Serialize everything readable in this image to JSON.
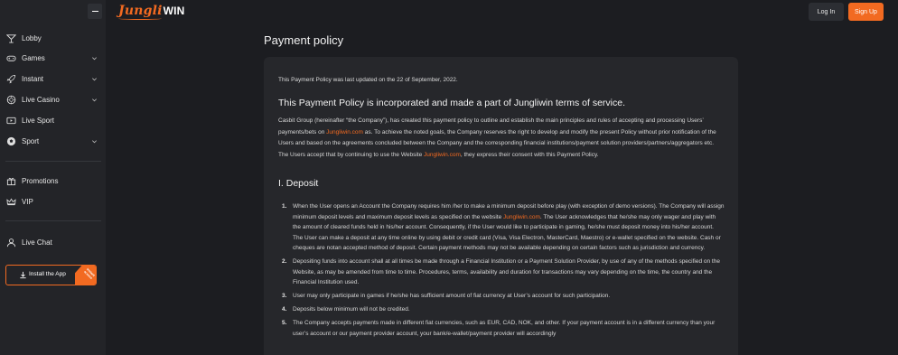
{
  "header": {
    "logo_main": "Jungli",
    "logo_accent": "WIN",
    "login_label": "Log In",
    "signup_label": "Sign Up"
  },
  "sidebar": {
    "items": [
      {
        "label": "Lobby",
        "icon": "cocktail-glass-icon",
        "chevron": false
      },
      {
        "label": "Games",
        "icon": "gamepad-icon",
        "chevron": true
      },
      {
        "label": "Instant",
        "icon": "rocket-icon",
        "chevron": true
      },
      {
        "label": "Live Casino",
        "icon": "casino-chip-icon",
        "chevron": true
      },
      {
        "label": "Live Sport",
        "icon": "live-tv-icon",
        "chevron": false
      },
      {
        "label": "Sport",
        "icon": "soccer-ball-icon",
        "chevron": true
      },
      {
        "label": "Promotions",
        "icon": "gift-icon",
        "chevron": false
      },
      {
        "label": "VIP",
        "icon": "crown-icon",
        "chevron": false
      },
      {
        "label": "Live Chat",
        "icon": "headset-icon",
        "chevron": false
      }
    ],
    "install_label": "Install the App",
    "install_ribbon": "Instant access"
  },
  "page": {
    "title": "Payment policy",
    "updated": "This Payment Policy was last updated on the 22 of September, 2022.",
    "heading": "This Payment Policy is incorporated and made a part of Jungliwin terms of service.",
    "intro": {
      "part1": "Casbit Group (hereinafter “the Company”), has created this payment policy to outline and establish the main principles and rules of accepting and processing Users’ payments/bets on ",
      "link1": "Jungliwin.com",
      "part2": " as. To achieve the noted goals, the Company reserves the right to develop and modify the present Policy without prior notification of the Users and based on the agreements concluded between the Company and the corresponding financial institutions/payment solution providers/partners/aggregators etc. The Users accept that by continuing to use the Website ",
      "link2": "Jungliwin.com",
      "part3": ", they express their consent with this Payment Policy."
    },
    "section_title": "I. Deposit",
    "deposit_items": [
      {
        "num": "1.",
        "pre": "When the User opens an Account the Company requires him /her to make a minimum deposit before play (with exception of demo versions). The Company will assign minimum deposit levels and maximum deposit levels as specified on the website ",
        "link": "Jungliwin.com",
        "post": ". The User acknowledges that he/she may only wager and play with the amount of cleared funds held in his/her account. Consequently, if the User would like to participate in gaming, he/she must deposit money into his/her account. The User can make a deposit at any time online by using debit or credit card (Visa, Visa Electron, MasterCard, Maestro) or e-wallet specified on the website. Cash or cheques are notan accepted method of deposit. Certain payment methods may not be available depending on certain factors such as jurisdiction and currency."
      },
      {
        "num": "2.",
        "pre": "Depositing funds into account shall at all times be made through a Financial Institution or a Payment Solution Provider, by use of any of the methods specified on the Website, as may be amended from time to time. Procedures, terms, availability and duration for transactions may vary depending on the time, the country and the Financial Institution used.",
        "link": "",
        "post": ""
      },
      {
        "num": "3.",
        "pre": "User may only participate in games if he/she has sufficient amount of fiat currency at User’s account for such participation.",
        "link": "",
        "post": ""
      },
      {
        "num": "4.",
        "pre": "Deposits below minimum will not be credited.",
        "link": "",
        "post": ""
      },
      {
        "num": "5.",
        "pre": "The Company accepts payments made in different fiat currencies, such as EUR, CAD, NOK, and other. If your payment account is in a different currency than your user’s account or our payment provider account, your bank/e-wallet/payment provider will accordingly",
        "link": "",
        "post": ""
      }
    ]
  },
  "colors": {
    "accent": "#f26a21",
    "background": "#1c1d21",
    "sidebar": "#232428",
    "card": "#26272b"
  }
}
